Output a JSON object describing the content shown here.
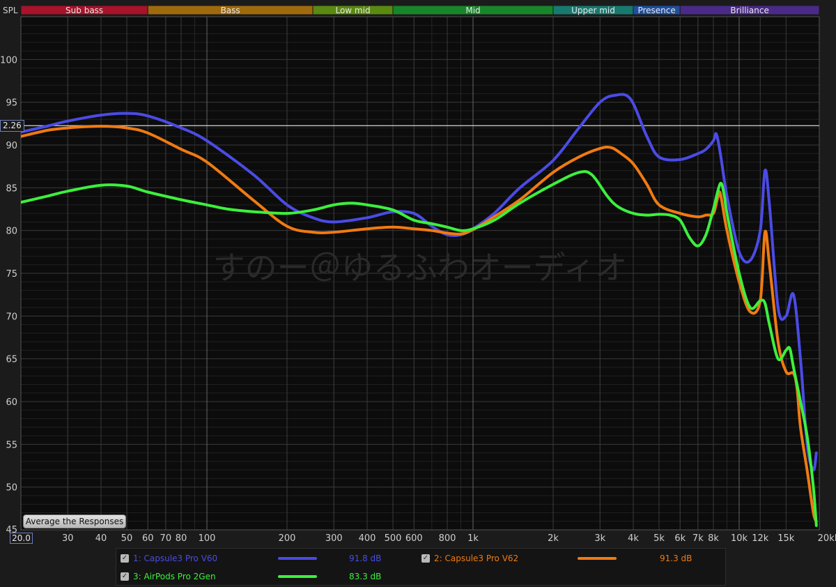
{
  "app": {
    "spl_label": "SPL",
    "cursor_readout": "2.26",
    "x_start_value": "20.0",
    "average_button": "Average the Responses",
    "watermark": "すのー＠ゆるふわオーディオ"
  },
  "bands": [
    {
      "label": "Sub bass",
      "color": "#a8122a",
      "from_hz": 20,
      "to_hz": 60
    },
    {
      "label": "Bass",
      "color": "#a06a0c",
      "from_hz": 60,
      "to_hz": 250
    },
    {
      "label": "Low mid",
      "color": "#5a8a10",
      "from_hz": 250,
      "to_hz": 500
    },
    {
      "label": "Mid",
      "color": "#17862a",
      "from_hz": 500,
      "to_hz": 2000
    },
    {
      "label": "Upper mid",
      "color": "#177a6e",
      "from_hz": 2000,
      "to_hz": 4000
    },
    {
      "label": "Presence",
      "color": "#1f4f9e",
      "from_hz": 4000,
      "to_hz": 6000
    },
    {
      "label": "Brilliance",
      "color": "#4a2a88",
      "from_hz": 6000,
      "to_hz": 20000
    }
  ],
  "legend": [
    {
      "index": "1",
      "name": "1: Capsule3 Pro V60",
      "value": "91.8 dB",
      "color": "#4b4be6",
      "checked": true
    },
    {
      "index": "2",
      "name": "2: Capsule3 Pro V62",
      "value": "91.3 dB",
      "color": "#f07a12",
      "checked": true
    },
    {
      "index": "3",
      "name": "3: AirPods Pro 2Gen",
      "value": "83.3 dB",
      "color": "#3cf03c",
      "checked": true
    }
  ],
  "chart_data": {
    "type": "line",
    "xlabel": "",
    "ylabel": "SPL",
    "x_scale": "log",
    "xlim": [
      20,
      20000
    ],
    "ylim": [
      45,
      105
    ],
    "grid": true,
    "cursor_y": 92.26,
    "x_ticks": [
      {
        "v": 20,
        "label": ""
      },
      {
        "v": 30,
        "label": "30"
      },
      {
        "v": 40,
        "label": "40"
      },
      {
        "v": 50,
        "label": "50"
      },
      {
        "v": 60,
        "label": "60"
      },
      {
        "v": 70,
        "label": "70"
      },
      {
        "v": 80,
        "label": "80"
      },
      {
        "v": 100,
        "label": "100"
      },
      {
        "v": 200,
        "label": "200"
      },
      {
        "v": 300,
        "label": "300"
      },
      {
        "v": 400,
        "label": "400"
      },
      {
        "v": 500,
        "label": "500"
      },
      {
        "v": 600,
        "label": "600"
      },
      {
        "v": 800,
        "label": "800"
      },
      {
        "v": 1000,
        "label": "1k"
      },
      {
        "v": 2000,
        "label": "2k"
      },
      {
        "v": 3000,
        "label": "3k"
      },
      {
        "v": 4000,
        "label": "4k"
      },
      {
        "v": 5000,
        "label": "5k"
      },
      {
        "v": 6000,
        "label": "6k"
      },
      {
        "v": 7000,
        "label": "7k"
      },
      {
        "v": 8000,
        "label": "8k"
      },
      {
        "v": 10000,
        "label": "10k"
      },
      {
        "v": 12000,
        "label": "12k"
      },
      {
        "v": 15000,
        "label": "15k"
      },
      {
        "v": 20000,
        "label": "20kHz"
      }
    ],
    "y_ticks": [
      {
        "v": 50,
        "label": "50"
      },
      {
        "v": 55,
        "label": "55"
      },
      {
        "v": 60,
        "label": "60"
      },
      {
        "v": 65,
        "label": "65"
      },
      {
        "v": 70,
        "label": "70"
      },
      {
        "v": 75,
        "label": "75"
      },
      {
        "v": 80,
        "label": "80"
      },
      {
        "v": 85,
        "label": "85"
      },
      {
        "v": 90,
        "label": "90"
      },
      {
        "v": 95,
        "label": "95"
      },
      {
        "v": 100,
        "label": "100"
      }
    ],
    "series": [
      {
        "name": "1: Capsule3 Pro V60",
        "color": "#4b4be6",
        "x": [
          20,
          25,
          30,
          40,
          50,
          60,
          80,
          100,
          150,
          200,
          250,
          300,
          400,
          500,
          600,
          700,
          800,
          900,
          1000,
          1200,
          1500,
          2000,
          2500,
          3000,
          3400,
          3900,
          4500,
          5000,
          6000,
          7000,
          7500,
          8000,
          8200,
          8500,
          9000,
          10000,
          11000,
          12000,
          12500,
          13000,
          14000,
          15000,
          16000,
          17000,
          18000,
          19000,
          19500
        ],
        "y": [
          91.5,
          92.2,
          92.8,
          93.5,
          93.7,
          93.4,
          92.0,
          90.5,
          86.5,
          83.0,
          81.5,
          81.0,
          81.5,
          82.2,
          82.0,
          80.5,
          79.5,
          79.5,
          80.2,
          82.0,
          85.0,
          88.2,
          92.0,
          95.0,
          95.8,
          95.4,
          91.0,
          88.6,
          88.3,
          89.0,
          89.5,
          90.5,
          91.3,
          89.0,
          84.0,
          77.5,
          76.5,
          80.0,
          87.0,
          83.0,
          71.0,
          70.0,
          72.5,
          65.0,
          55.0,
          52.0,
          54.0
        ]
      },
      {
        "name": "2: Capsule3 Pro V62",
        "color": "#f07a12",
        "x": [
          20,
          25,
          30,
          40,
          50,
          60,
          80,
          100,
          150,
          200,
          250,
          300,
          400,
          500,
          600,
          700,
          800,
          900,
          1000,
          1200,
          1500,
          2000,
          2500,
          3000,
          3300,
          3600,
          4000,
          4500,
          5000,
          6000,
          7000,
          7500,
          8000,
          8300,
          8500,
          9000,
          10000,
          11000,
          12000,
          12500,
          13000,
          14000,
          15000,
          16000,
          16500,
          17000,
          18000,
          19000,
          19500
        ],
        "y": [
          91.0,
          91.7,
          92.0,
          92.2,
          92.0,
          91.4,
          89.5,
          88.0,
          83.5,
          80.5,
          79.8,
          79.8,
          80.2,
          80.4,
          80.2,
          80.0,
          79.7,
          79.6,
          80.1,
          81.6,
          83.6,
          86.8,
          88.6,
          89.6,
          89.7,
          89.0,
          87.8,
          85.4,
          83.0,
          82.0,
          81.6,
          81.8,
          82.0,
          83.8,
          84.3,
          80.0,
          74.0,
          70.5,
          71.8,
          79.8,
          76.0,
          67.0,
          63.5,
          63.3,
          61.5,
          57.0,
          52.0,
          47.0,
          46.0
        ]
      },
      {
        "name": "3: AirPods Pro 2Gen",
        "color": "#3cf03c",
        "x": [
          20,
          25,
          30,
          40,
          50,
          60,
          80,
          100,
          120,
          150,
          200,
          250,
          300,
          350,
          400,
          500,
          600,
          700,
          800,
          900,
          1000,
          1200,
          1500,
          2000,
          2500,
          2800,
          3200,
          3500,
          4000,
          4500,
          5000,
          5500,
          6000,
          6500,
          7000,
          7500,
          8000,
          8500,
          8800,
          9000,
          10000,
          11000,
          12000,
          12500,
          13000,
          14000,
          15000,
          15500,
          16000,
          17000,
          18000,
          19000,
          19500
        ],
        "y": [
          83.3,
          84.0,
          84.6,
          85.3,
          85.2,
          84.5,
          83.6,
          83.0,
          82.5,
          82.2,
          82.0,
          82.4,
          83.0,
          83.2,
          83.0,
          82.4,
          81.2,
          80.8,
          80.4,
          80.0,
          80.2,
          81.2,
          83.2,
          85.4,
          86.8,
          86.5,
          84.0,
          82.8,
          82.0,
          81.8,
          81.9,
          81.8,
          81.2,
          79.2,
          78.2,
          79.5,
          82.5,
          85.5,
          84.0,
          82.0,
          75.0,
          71.0,
          71.8,
          71.5,
          69.0,
          65.0,
          66.0,
          66.2,
          64.0,
          60.0,
          56.0,
          50.0,
          45.5
        ]
      }
    ]
  }
}
